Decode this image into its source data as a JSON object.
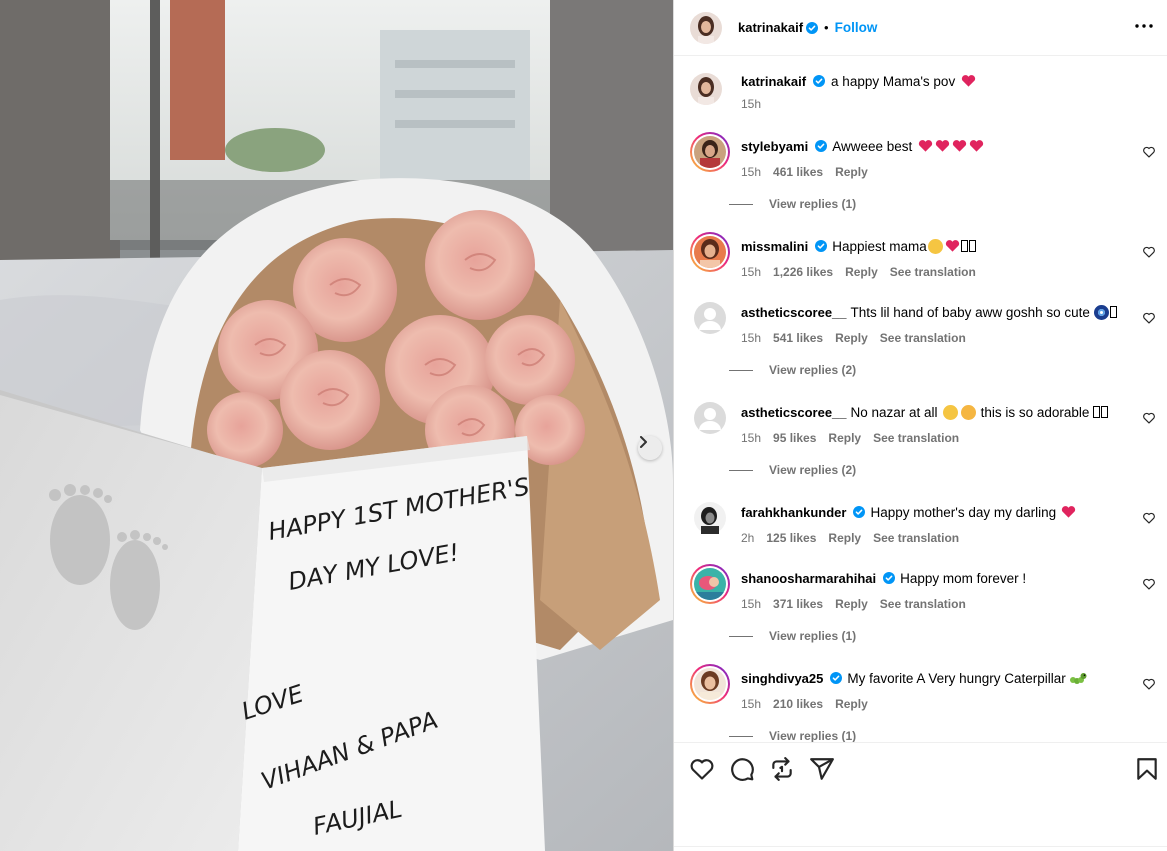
{
  "post": {
    "author": "katrinakaif",
    "follow_label": "Follow",
    "dot": "•",
    "caption": {
      "username": "katrinakaif",
      "text": "a happy Mama's pov",
      "time": "15h"
    },
    "card_text": {
      "line1": "HAPPY 1ST MOTHER'S",
      "line2": "DAY MY LOVE!",
      "line3": "LOVE",
      "line4": "VIHAAN & PAPA",
      "line5": "FAUJIAL"
    }
  },
  "comments": [
    {
      "username": "stylebyami",
      "text": "Awweee best",
      "time": "15h",
      "likes": "461 likes",
      "reply": "Reply",
      "see_translation": "",
      "view_replies": "View replies (1)"
    },
    {
      "username": "missmalini",
      "text": "Happiest mama",
      "time": "15h",
      "likes": "1,226 likes",
      "reply": "Reply",
      "see_translation": "See translation",
      "view_replies": ""
    },
    {
      "username": "astheticscoree__",
      "text": "Thts lil hand of baby aww goshh so cute",
      "time": "15h",
      "likes": "541 likes",
      "reply": "Reply",
      "see_translation": "See translation",
      "view_replies": "View replies (2)"
    },
    {
      "username": "astheticscoree__",
      "text": "No nazar at all",
      "text2": "this is so adorable",
      "time": "15h",
      "likes": "95 likes",
      "reply": "Reply",
      "see_translation": "See translation",
      "view_replies": "View replies (2)"
    },
    {
      "username": "farahkhankunder",
      "text": "Happy mother's day my darling",
      "time": "2h",
      "likes": "125 likes",
      "reply": "Reply",
      "see_translation": "See translation",
      "view_replies": ""
    },
    {
      "username": "shanoosharmarahihai",
      "text": "Happy mom forever !",
      "time": "15h",
      "likes": "371 likes",
      "reply": "Reply",
      "see_translation": "See translation",
      "view_replies": "View replies (1)"
    },
    {
      "username": "singhdivya25",
      "text": "My favorite A Very hungry Caterpillar",
      "time": "15h",
      "likes": "210 likes",
      "reply": "Reply",
      "see_translation": "",
      "view_replies": "View replies (1)"
    }
  ],
  "icons": {
    "like": "heart-icon",
    "comment": "comment-icon",
    "repost": "repost-icon",
    "share": "share-icon",
    "save": "bookmark-icon",
    "more": "more-options-icon",
    "next": "chevron-right-icon",
    "verified": "verified-badge-icon"
  },
  "colors": {
    "accent": "#0095f6",
    "verified": "#0095f6",
    "muted": "#737373",
    "heart": "#e0245e"
  }
}
